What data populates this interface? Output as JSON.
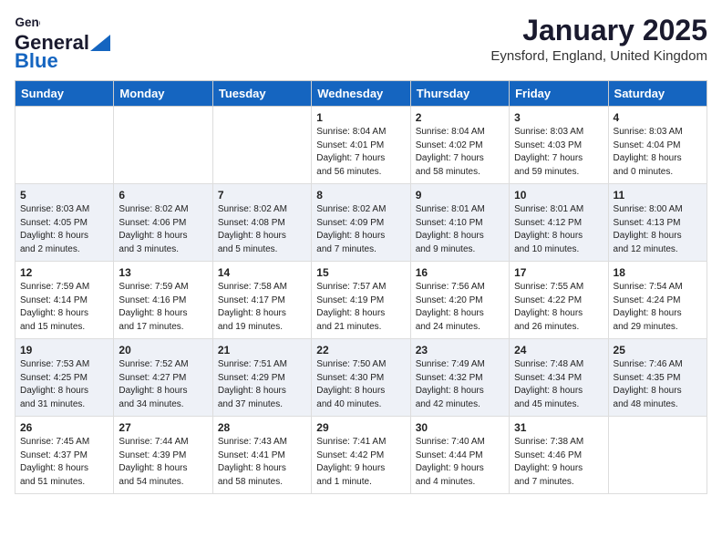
{
  "app": {
    "logo_general": "General",
    "logo_blue": "Blue",
    "month": "January 2025",
    "location": "Eynsford, England, United Kingdom"
  },
  "calendar": {
    "headers": [
      "Sunday",
      "Monday",
      "Tuesday",
      "Wednesday",
      "Thursday",
      "Friday",
      "Saturday"
    ],
    "weeks": [
      {
        "days": [
          {
            "num": "",
            "info": ""
          },
          {
            "num": "",
            "info": ""
          },
          {
            "num": "",
            "info": ""
          },
          {
            "num": "1",
            "info": "Sunrise: 8:04 AM\nSunset: 4:01 PM\nDaylight: 7 hours\nand 56 minutes."
          },
          {
            "num": "2",
            "info": "Sunrise: 8:04 AM\nSunset: 4:02 PM\nDaylight: 7 hours\nand 58 minutes."
          },
          {
            "num": "3",
            "info": "Sunrise: 8:03 AM\nSunset: 4:03 PM\nDaylight: 7 hours\nand 59 minutes."
          },
          {
            "num": "4",
            "info": "Sunrise: 8:03 AM\nSunset: 4:04 PM\nDaylight: 8 hours\nand 0 minutes."
          }
        ]
      },
      {
        "days": [
          {
            "num": "5",
            "info": "Sunrise: 8:03 AM\nSunset: 4:05 PM\nDaylight: 8 hours\nand 2 minutes."
          },
          {
            "num": "6",
            "info": "Sunrise: 8:02 AM\nSunset: 4:06 PM\nDaylight: 8 hours\nand 3 minutes."
          },
          {
            "num": "7",
            "info": "Sunrise: 8:02 AM\nSunset: 4:08 PM\nDaylight: 8 hours\nand 5 minutes."
          },
          {
            "num": "8",
            "info": "Sunrise: 8:02 AM\nSunset: 4:09 PM\nDaylight: 8 hours\nand 7 minutes."
          },
          {
            "num": "9",
            "info": "Sunrise: 8:01 AM\nSunset: 4:10 PM\nDaylight: 8 hours\nand 9 minutes."
          },
          {
            "num": "10",
            "info": "Sunrise: 8:01 AM\nSunset: 4:12 PM\nDaylight: 8 hours\nand 10 minutes."
          },
          {
            "num": "11",
            "info": "Sunrise: 8:00 AM\nSunset: 4:13 PM\nDaylight: 8 hours\nand 12 minutes."
          }
        ]
      },
      {
        "days": [
          {
            "num": "12",
            "info": "Sunrise: 7:59 AM\nSunset: 4:14 PM\nDaylight: 8 hours\nand 15 minutes."
          },
          {
            "num": "13",
            "info": "Sunrise: 7:59 AM\nSunset: 4:16 PM\nDaylight: 8 hours\nand 17 minutes."
          },
          {
            "num": "14",
            "info": "Sunrise: 7:58 AM\nSunset: 4:17 PM\nDaylight: 8 hours\nand 19 minutes."
          },
          {
            "num": "15",
            "info": "Sunrise: 7:57 AM\nSunset: 4:19 PM\nDaylight: 8 hours\nand 21 minutes."
          },
          {
            "num": "16",
            "info": "Sunrise: 7:56 AM\nSunset: 4:20 PM\nDaylight: 8 hours\nand 24 minutes."
          },
          {
            "num": "17",
            "info": "Sunrise: 7:55 AM\nSunset: 4:22 PM\nDaylight: 8 hours\nand 26 minutes."
          },
          {
            "num": "18",
            "info": "Sunrise: 7:54 AM\nSunset: 4:24 PM\nDaylight: 8 hours\nand 29 minutes."
          }
        ]
      },
      {
        "days": [
          {
            "num": "19",
            "info": "Sunrise: 7:53 AM\nSunset: 4:25 PM\nDaylight: 8 hours\nand 31 minutes."
          },
          {
            "num": "20",
            "info": "Sunrise: 7:52 AM\nSunset: 4:27 PM\nDaylight: 8 hours\nand 34 minutes."
          },
          {
            "num": "21",
            "info": "Sunrise: 7:51 AM\nSunset: 4:29 PM\nDaylight: 8 hours\nand 37 minutes."
          },
          {
            "num": "22",
            "info": "Sunrise: 7:50 AM\nSunset: 4:30 PM\nDaylight: 8 hours\nand 40 minutes."
          },
          {
            "num": "23",
            "info": "Sunrise: 7:49 AM\nSunset: 4:32 PM\nDaylight: 8 hours\nand 42 minutes."
          },
          {
            "num": "24",
            "info": "Sunrise: 7:48 AM\nSunset: 4:34 PM\nDaylight: 8 hours\nand 45 minutes."
          },
          {
            "num": "25",
            "info": "Sunrise: 7:46 AM\nSunset: 4:35 PM\nDaylight: 8 hours\nand 48 minutes."
          }
        ]
      },
      {
        "days": [
          {
            "num": "26",
            "info": "Sunrise: 7:45 AM\nSunset: 4:37 PM\nDaylight: 8 hours\nand 51 minutes."
          },
          {
            "num": "27",
            "info": "Sunrise: 7:44 AM\nSunset: 4:39 PM\nDaylight: 8 hours\nand 54 minutes."
          },
          {
            "num": "28",
            "info": "Sunrise: 7:43 AM\nSunset: 4:41 PM\nDaylight: 8 hours\nand 58 minutes."
          },
          {
            "num": "29",
            "info": "Sunrise: 7:41 AM\nSunset: 4:42 PM\nDaylight: 9 hours\nand 1 minute."
          },
          {
            "num": "30",
            "info": "Sunrise: 7:40 AM\nSunset: 4:44 PM\nDaylight: 9 hours\nand 4 minutes."
          },
          {
            "num": "31",
            "info": "Sunrise: 7:38 AM\nSunset: 4:46 PM\nDaylight: 9 hours\nand 7 minutes."
          },
          {
            "num": "",
            "info": ""
          }
        ]
      }
    ]
  }
}
